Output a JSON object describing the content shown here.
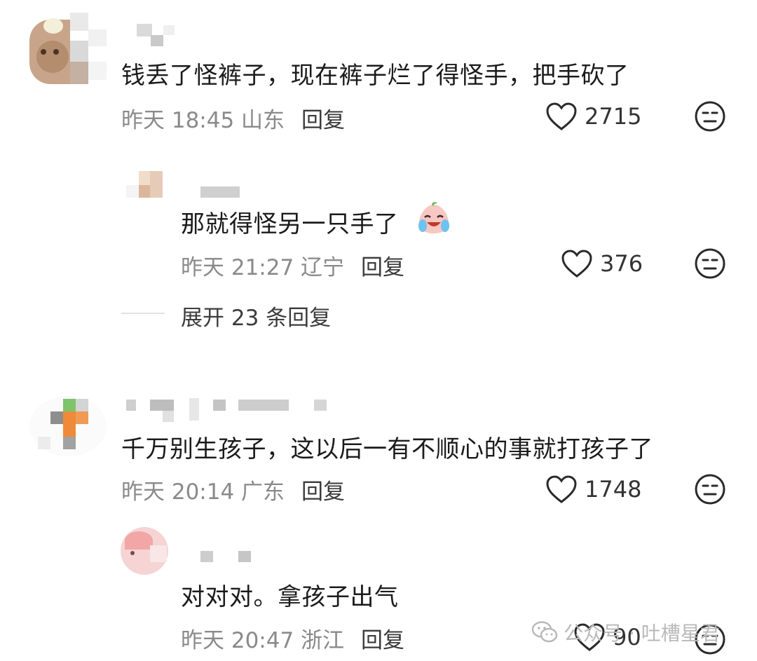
{
  "comments": [
    {
      "text": "钱丢了怪裤子，现在裤子烂了得怪手，把手砍了",
      "date": "昨天 18:45 山东",
      "reply_label": "回复",
      "likes": "2715",
      "reply": {
        "text": "那就得怪另一只手了",
        "date": "昨天 21:27 辽宁",
        "reply_label": "回复",
        "likes": "376"
      },
      "expand_label": "展开 23 条回复"
    },
    {
      "text": "千万别生孩子，这以后一有不顺心的事就打孩子了",
      "date": "昨天 20:14 广东",
      "reply_label": "回复",
      "likes": "1748",
      "reply": {
        "text": "对对对。拿孩子出气",
        "date": "昨天 20:47 浙江",
        "reply_label": "回复",
        "likes": "90"
      }
    }
  ],
  "watermark": "公众号 · 吐槽星君",
  "icons": [
    "heart-outline-icon",
    "dislike-face-icon",
    "crying-laughing-emoji-icon",
    "wechat-icon"
  ]
}
